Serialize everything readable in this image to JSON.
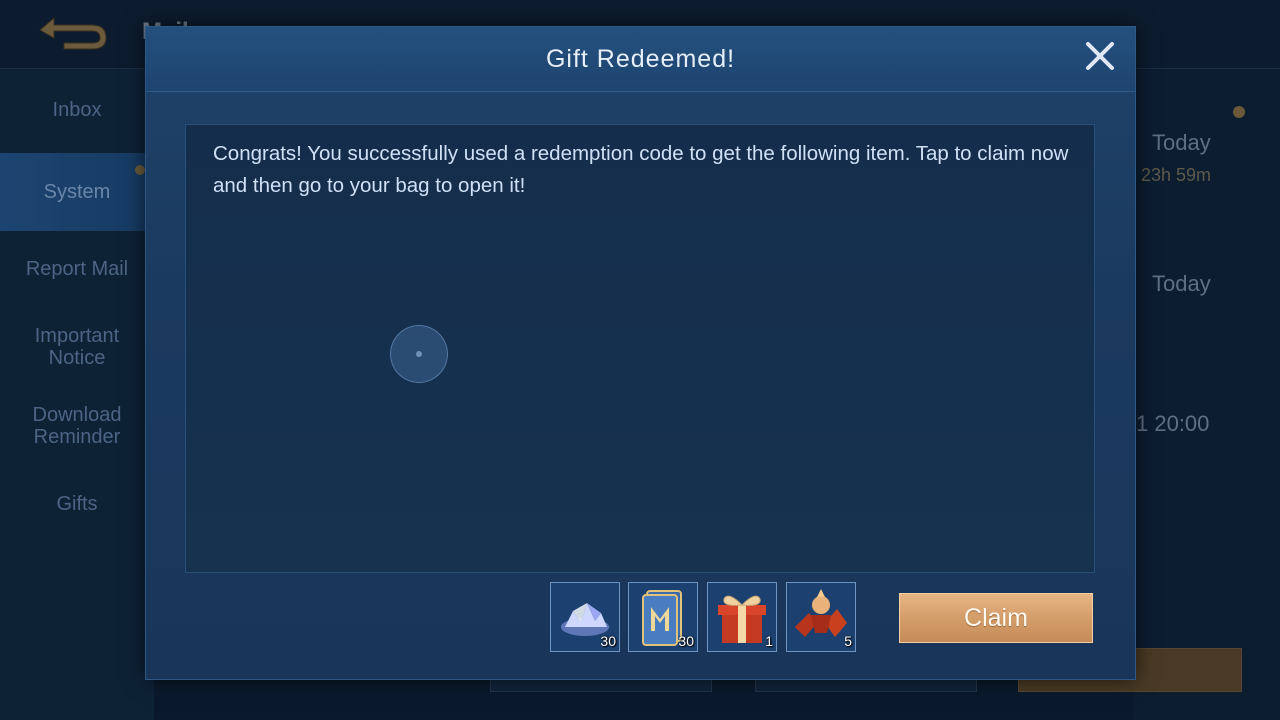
{
  "background": {
    "title": "Mail",
    "sidebar": [
      {
        "label": "Inbox"
      },
      {
        "label": "System"
      },
      {
        "label": "Report Mail"
      },
      {
        "label": "Important Notice"
      },
      {
        "label": "Download Reminder"
      },
      {
        "label": "Gifts"
      }
    ],
    "entries": [
      {
        "date": "Today",
        "remaining": "23h 59m"
      },
      {
        "date": "Today"
      },
      {
        "date": "1 20:00"
      }
    ]
  },
  "modal": {
    "title": "Gift Redeemed!",
    "message": "Congrats! You successfully used a redemption code to get the following item. Tap to claim now and then go to your bag to open it!",
    "rewards": [
      {
        "icon": "crystal-icon",
        "count": "30"
      },
      {
        "icon": "m-card-icon",
        "count": "30"
      },
      {
        "icon": "gift-box-icon",
        "count": "1"
      },
      {
        "icon": "fragment-icon",
        "count": "5"
      }
    ],
    "claim_label": "Claim"
  },
  "colors": {
    "accent_gold": "#d9a46f",
    "modal_blue": "#1b3a5f",
    "text_light": "#cfe0f5"
  }
}
